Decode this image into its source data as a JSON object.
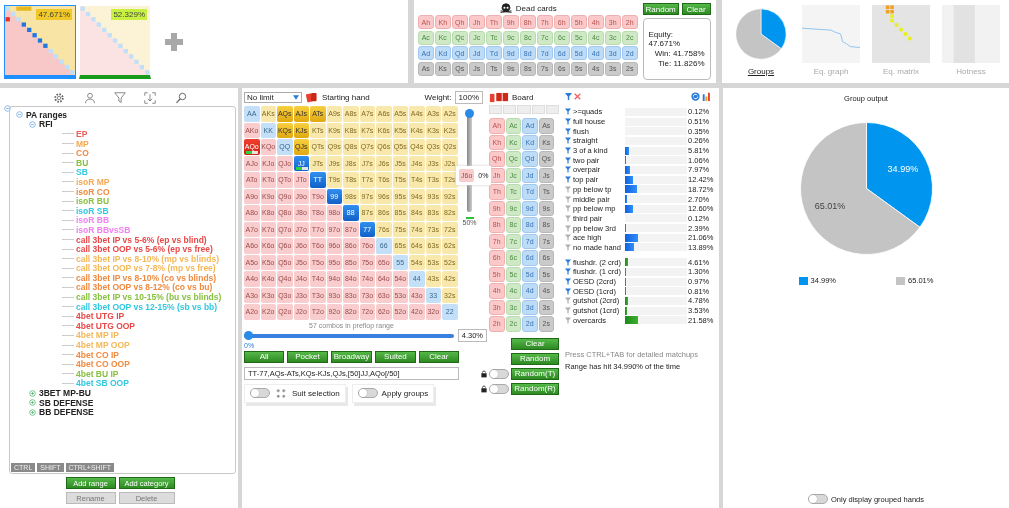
{
  "ranges": [
    {
      "value": "47.671%",
      "selected": true,
      "color": "#1e90ff"
    },
    {
      "value": "52.329%",
      "selected": false,
      "color": "#1a9a1a"
    }
  ],
  "dead_cards": {
    "title": "Dead cards",
    "rows": [
      [
        "Ah",
        "Kh",
        "Qh",
        "Jh",
        "Th",
        "9h",
        "8h",
        "7h",
        "6h",
        "5h",
        "4h",
        "3h",
        "2h"
      ],
      [
        "Ac",
        "Kc",
        "Qc",
        "Jc",
        "Tc",
        "9c",
        "8c",
        "7c",
        "6c",
        "5c",
        "4c",
        "3c",
        "2c"
      ],
      [
        "Ad",
        "Kd",
        "Qd",
        "Jd",
        "Td",
        "9d",
        "8d",
        "7d",
        "6d",
        "5d",
        "4d",
        "3d",
        "2d"
      ],
      [
        "As",
        "Ks",
        "Qs",
        "Js",
        "Ts",
        "9s",
        "8s",
        "7s",
        "6s",
        "5s",
        "4s",
        "3s",
        "2s"
      ]
    ],
    "buttons": [
      "Random",
      "Clear"
    ]
  },
  "equity": [
    "Equity: 47.671%",
    "Win: 41.758%",
    "Tie: 11.826%"
  ],
  "views": [
    {
      "label": "Groups",
      "selected": true,
      "kind": "pie"
    },
    {
      "label": "Eq. graph",
      "selected": false,
      "kind": "graph"
    },
    {
      "label": "Eq. matrix",
      "selected": false,
      "kind": "matrix"
    },
    {
      "label": "Hotness",
      "selected": false,
      "kind": "hotness"
    }
  ],
  "tree": [
    {
      "label": "PA ranges",
      "expanded": true,
      "children": [
        {
          "label": "RFI",
          "expanded": true,
          "children": [
            {
              "label": "EP",
              "color": "#e8605a"
            },
            {
              "label": "MP",
              "color": "#f5a850"
            },
            {
              "label": "CO",
              "color": "#f08a40"
            },
            {
              "label": "BU",
              "color": "#88c040"
            },
            {
              "label": "SB",
              "color": "#30c8e0"
            },
            {
              "label": "isoR MP",
              "color": "#f5a850"
            },
            {
              "label": "isoR CO",
              "color": "#f08a40"
            },
            {
              "label": "isoR BU",
              "color": "#88c040"
            },
            {
              "label": "isoR SB",
              "color": "#30c8e0"
            },
            {
              "label": "isoR BB",
              "color": "#f080f0"
            },
            {
              "label": "isoR BBvsSB",
              "color": "#f080f0"
            },
            {
              "label": "call 3bet IP vs 5-6% (ep vs blind)",
              "color": "#e84848"
            },
            {
              "label": "call 3bet OOP vs 5-6% (ep vs free)",
              "color": "#e84848"
            },
            {
              "label": "call 3bet IP vs 8-10% (mp vs blinds)",
              "color": "#f5b858"
            },
            {
              "label": "call 3bet OOP vs 7-8% (mp vs free)",
              "color": "#f5b858"
            },
            {
              "label": "call 3bet IP vs 8-10% (co vs blinds)",
              "color": "#f08a40"
            },
            {
              "label": "call 3bet OOP vs 8-12% (co vs bu)",
              "color": "#f08a40"
            },
            {
              "label": "call 3bet IP vs 10-15% (bu vs blinds)",
              "color": "#88c040"
            },
            {
              "label": "call 3bet OOP vs 12-15% (sb vs bb)",
              "color": "#30c8e0"
            },
            {
              "label": "4bet UTG IP",
              "color": "#e84848"
            },
            {
              "label": "4bet UTG OOP",
              "color": "#e84848"
            },
            {
              "label": "4bet MP IP",
              "color": "#f5b858"
            },
            {
              "label": "4bet MP OOP",
              "color": "#f5b858"
            },
            {
              "label": "4bet CO IP",
              "color": "#f08a40"
            },
            {
              "label": "4bet CO OOP",
              "color": "#f08a40"
            },
            {
              "label": "4bet BU IP",
              "color": "#88c040"
            },
            {
              "label": "4bet SB OOP",
              "color": "#30c8e0"
            }
          ]
        },
        {
          "label": "3BET MP-BU",
          "expanded": false
        },
        {
          "label": "SB DEFENSE",
          "expanded": false
        },
        {
          "label": "BB DEFENSE",
          "expanded": false
        }
      ]
    }
  ],
  "keys": [
    "CTRL",
    "SHIFT",
    "CTRL+SHIFT"
  ],
  "tree_buttons": [
    {
      "label": "Add range",
      "disabled": false
    },
    {
      "label": "Add category",
      "disabled": false
    },
    {
      "label": "Rename",
      "disabled": true
    },
    {
      "label": "Delete",
      "disabled": true
    }
  ],
  "hand_panel": {
    "game": "No limit",
    "title": "Starting hand",
    "weight_label": "Weight:",
    "weight": "100%",
    "weight_slider": {
      "level": 1
    },
    "weight_mark": "50%",
    "tooltip": {
      "hand": "J6o",
      "value": "0%"
    },
    "rows": [
      [
        {
          "label": "AA",
          "selected": false
        },
        {
          "label": "AKs",
          "selected": false
        },
        {
          "label": "AQs",
          "selected": true
        },
        {
          "label": "AJs",
          "selected": true
        },
        {
          "label": "ATs",
          "selected": true
        },
        {
          "label": "A9s",
          "selected": false
        },
        {
          "label": "A8s",
          "selected": false
        },
        {
          "label": "A7s",
          "selected": false
        },
        {
          "label": "A6s",
          "selected": false
        },
        {
          "label": "A5s",
          "selected": false
        },
        {
          "label": "A4s",
          "selected": false
        },
        {
          "label": "A3s",
          "selected": false
        },
        {
          "label": "A2s",
          "selected": false
        }
      ],
      [
        {
          "label": "AKo",
          "selected": false
        },
        {
          "label": "KK",
          "selected": false
        },
        {
          "label": "KQs",
          "selected": true
        },
        {
          "label": "KJs",
          "selected": true
        },
        {
          "label": "KTs",
          "selected": false
        },
        {
          "label": "K9s",
          "selected": false
        },
        {
          "label": "K8s",
          "selected": false
        },
        {
          "label": "K7s",
          "selected": false
        },
        {
          "label": "K6s",
          "selected": false
        },
        {
          "label": "K5s",
          "selected": false
        },
        {
          "label": "K4s",
          "selected": false
        },
        {
          "label": "K3s",
          "selected": false
        },
        {
          "label": "K2s",
          "selected": false
        }
      ],
      [
        {
          "label": "AQo",
          "selected": true,
          "level": 0.5
        },
        {
          "label": "KQo",
          "selected": false
        },
        {
          "label": "QQ",
          "selected": false
        },
        {
          "label": "QJs",
          "selected": true
        },
        {
          "label": "QTs",
          "selected": false
        },
        {
          "label": "Q9s",
          "selected": false
        },
        {
          "label": "Q8s",
          "selected": false
        },
        {
          "label": "Q7s",
          "selected": false
        },
        {
          "label": "Q6s",
          "selected": false
        },
        {
          "label": "Q5s",
          "selected": false
        },
        {
          "label": "Q4s",
          "selected": false
        },
        {
          "label": "Q3s",
          "selected": false
        },
        {
          "label": "Q2s",
          "selected": false
        }
      ],
      [
        {
          "label": "AJo",
          "selected": false
        },
        {
          "label": "KJo",
          "selected": false
        },
        {
          "label": "QJo",
          "selected": false
        },
        {
          "label": "JJ",
          "selected": true,
          "level": 0.5
        },
        {
          "label": "JTs",
          "selected": false
        },
        {
          "label": "J9s",
          "selected": false
        },
        {
          "label": "J8s",
          "selected": false
        },
        {
          "label": "J7s",
          "selected": false
        },
        {
          "label": "J6s",
          "selected": false
        },
        {
          "label": "J5s",
          "selected": false
        },
        {
          "label": "J4s",
          "selected": false
        },
        {
          "label": "J3s",
          "selected": false
        },
        {
          "label": "J2s",
          "selected": false
        }
      ],
      [
        {
          "label": "ATo",
          "selected": false
        },
        {
          "label": "KTo",
          "selected": false
        },
        {
          "label": "QTo",
          "selected": false
        },
        {
          "label": "JTo",
          "selected": false
        },
        {
          "label": "TT",
          "selected": true
        },
        {
          "label": "T9s",
          "selected": false
        },
        {
          "label": "T8s",
          "selected": false
        },
        {
          "label": "T7s",
          "selected": false
        },
        {
          "label": "T6s",
          "selected": false
        },
        {
          "label": "T5s",
          "selected": false
        },
        {
          "label": "T4s",
          "selected": false
        },
        {
          "label": "T3s",
          "selected": false
        },
        {
          "label": "T2s",
          "selected": false
        }
      ],
      [
        {
          "label": "A9o",
          "selected": false
        },
        {
          "label": "K9o",
          "selected": false
        },
        {
          "label": "Q9o",
          "selected": false
        },
        {
          "label": "J9o",
          "selected": false
        },
        {
          "label": "T9o",
          "selected": false
        },
        {
          "label": "99",
          "selected": true
        },
        {
          "label": "98s",
          "selected": false
        },
        {
          "label": "97s",
          "selected": false
        },
        {
          "label": "96s",
          "selected": false
        },
        {
          "label": "95s",
          "selected": false
        },
        {
          "label": "94s",
          "selected": false
        },
        {
          "label": "93s",
          "selected": false
        },
        {
          "label": "92s",
          "selected": false
        }
      ],
      [
        {
          "label": "A8o",
          "selected": false
        },
        {
          "label": "K8o",
          "selected": false
        },
        {
          "label": "Q8o",
          "selected": false
        },
        {
          "label": "J8o",
          "selected": false
        },
        {
          "label": "T8o",
          "selected": false
        },
        {
          "label": "98o",
          "selected": false
        },
        {
          "label": "88",
          "selected": true
        },
        {
          "label": "87s",
          "selected": false
        },
        {
          "label": "86s",
          "selected": false
        },
        {
          "label": "85s",
          "selected": false
        },
        {
          "label": "84s",
          "selected": false
        },
        {
          "label": "83s",
          "selected": false
        },
        {
          "label": "82s",
          "selected": false
        }
      ],
      [
        {
          "label": "A7o",
          "selected": false
        },
        {
          "label": "K7o",
          "selected": false
        },
        {
          "label": "Q7o",
          "selected": false
        },
        {
          "label": "J7o",
          "selected": false
        },
        {
          "label": "T7o",
          "selected": false
        },
        {
          "label": "97o",
          "selected": false
        },
        {
          "label": "87o",
          "selected": false
        },
        {
          "label": "77",
          "selected": true
        },
        {
          "label": "76s",
          "selected": false
        },
        {
          "label": "75s",
          "selected": false
        },
        {
          "label": "74s",
          "selected": false
        },
        {
          "label": "73s",
          "selected": false
        },
        {
          "label": "72s",
          "selected": false
        }
      ],
      [
        {
          "label": "A6o",
          "selected": false
        },
        {
          "label": "K6o",
          "selected": false
        },
        {
          "label": "Q6o",
          "selected": false
        },
        {
          "label": "J6o",
          "selected": false
        },
        {
          "label": "T6o",
          "selected": false
        },
        {
          "label": "96o",
          "selected": false
        },
        {
          "label": "86o",
          "selected": false
        },
        {
          "label": "76o",
          "selected": false
        },
        {
          "label": "66",
          "selected": false
        },
        {
          "label": "65s",
          "selected": false
        },
        {
          "label": "64s",
          "selected": false
        },
        {
          "label": "63s",
          "selected": false
        },
        {
          "label": "62s",
          "selected": false
        }
      ],
      [
        {
          "label": "A5o",
          "selected": false
        },
        {
          "label": "K5o",
          "selected": false
        },
        {
          "label": "Q5o",
          "selected": false
        },
        {
          "label": "J5o",
          "selected": false
        },
        {
          "label": "T5o",
          "selected": false
        },
        {
          "label": "95o",
          "selected": false
        },
        {
          "label": "85o",
          "selected": false
        },
        {
          "label": "75o",
          "selected": false
        },
        {
          "label": "65o",
          "selected": false
        },
        {
          "label": "55",
          "selected": false
        },
        {
          "label": "54s",
          "selected": false
        },
        {
          "label": "53s",
          "selected": false
        },
        {
          "label": "52s",
          "selected": false
        }
      ],
      [
        {
          "label": "A4o",
          "selected": false
        },
        {
          "label": "K4o",
          "selected": false
        },
        {
          "label": "Q4o",
          "selected": false
        },
        {
          "label": "J4o",
          "selected": false
        },
        {
          "label": "T4o",
          "selected": false
        },
        {
          "label": "94o",
          "selected": false
        },
        {
          "label": "84o",
          "selected": false
        },
        {
          "label": "74o",
          "selected": false
        },
        {
          "label": "64o",
          "selected": false
        },
        {
          "label": "54o",
          "selected": false
        },
        {
          "label": "44",
          "selected": false
        },
        {
          "label": "43s",
          "selected": false
        },
        {
          "label": "42s",
          "selected": false
        }
      ],
      [
        {
          "label": "A3o",
          "selected": false
        },
        {
          "label": "K3o",
          "selected": false
        },
        {
          "label": "Q3o",
          "selected": false
        },
        {
          "label": "J3o",
          "selected": false
        },
        {
          "label": "T3o",
          "selected": false
        },
        {
          "label": "93o",
          "selected": false
        },
        {
          "label": "83o",
          "selected": false
        },
        {
          "label": "73o",
          "selected": false
        },
        {
          "label": "63o",
          "selected": false
        },
        {
          "label": "53o",
          "selected": false
        },
        {
          "label": "43o",
          "selected": false
        },
        {
          "label": "33",
          "selected": false
        },
        {
          "label": "32s",
          "selected": false
        }
      ],
      [
        {
          "label": "A2o",
          "selected": false
        },
        {
          "label": "K2o",
          "selected": false
        },
        {
          "label": "Q2o",
          "selected": false
        },
        {
          "label": "J2o",
          "selected": false
        },
        {
          "label": "T2o",
          "selected": false
        },
        {
          "label": "92o",
          "selected": false
        },
        {
          "label": "82o",
          "selected": false
        },
        {
          "label": "72o",
          "selected": false
        },
        {
          "label": "62o",
          "selected": false
        },
        {
          "label": "52o",
          "selected": false
        },
        {
          "label": "42o",
          "selected": false
        },
        {
          "label": "32o",
          "selected": false
        },
        {
          "label": "22",
          "selected": false
        }
      ]
    ],
    "combos": "57 combos in preflop range",
    "range_slider": {
      "level": 0
    },
    "range_min": "0%",
    "range_percent": "4.30%",
    "buttons": [
      "All",
      "Pocket",
      "Broadway",
      "Suited",
      "Clear"
    ],
    "range_text": "TT-77,AQs-ATs,KQs-KJs,QJs,[50]JJ,AQo[/50]",
    "suit_selection": {
      "label": "Suit selection",
      "on": false
    },
    "apply_groups": {
      "label": "Apply groups",
      "on": false
    }
  },
  "board": {
    "title": "Board",
    "rows": [
      [
        "Ah",
        "Ac",
        "Ad",
        "As"
      ],
      [
        "Kh",
        "Kc",
        "Kd",
        "Ks"
      ],
      [
        "Qh",
        "Qc",
        "Qd",
        "Qs"
      ],
      [
        "Jh",
        "Jc",
        "Jd",
        "Js"
      ],
      [
        "Th",
        "Tc",
        "Td",
        "Ts"
      ],
      [
        "9h",
        "9c",
        "9d",
        "9s"
      ],
      [
        "8h",
        "8c",
        "8d",
        "8s"
      ],
      [
        "7h",
        "7c",
        "7d",
        "7s"
      ],
      [
        "6h",
        "6c",
        "6d",
        "6s"
      ],
      [
        "5h",
        "5c",
        "5d",
        "5s"
      ],
      [
        "4h",
        "4c",
        "4d",
        "4s"
      ],
      [
        "3h",
        "3c",
        "3d",
        "3s"
      ],
      [
        "2h",
        "2c",
        "2d",
        "2s"
      ]
    ],
    "buttons": [
      {
        "label": "Clear"
      },
      {
        "label": "Random"
      },
      {
        "label": "Random(T)",
        "lock": {
          "on": false
        }
      },
      {
        "label": "Random(R)",
        "lock": {
          "on": false
        }
      }
    ]
  },
  "stats": {
    "made_hands": [
      {
        "label": ">=quads",
        "active": true,
        "level": 0.0012,
        "value": "0.12%"
      },
      {
        "label": "full house",
        "active": true,
        "level": 0.0051,
        "value": "0.51%"
      },
      {
        "label": "flush",
        "active": true,
        "level": 0.0035,
        "value": "0.35%"
      },
      {
        "label": "straight",
        "active": true,
        "level": 0.0026,
        "value": "0.26%"
      },
      {
        "label": "3 of a kind",
        "active": true,
        "level": 0.0581,
        "value": "5.81%"
      },
      {
        "label": "two pair",
        "active": true,
        "level": 0.0106,
        "value": "1.06%"
      },
      {
        "label": "overpair",
        "active": true,
        "level": 0.0797,
        "value": "7.97%"
      },
      {
        "label": "top pair",
        "active": true,
        "level": 0.1242,
        "value": "12.42%"
      },
      {
        "label": "pp below tp",
        "active": false,
        "level": 0.1872,
        "value": "18.72%"
      },
      {
        "label": "middle pair",
        "active": false,
        "level": 0.027,
        "value": "2.70%"
      },
      {
        "label": "pp below mp",
        "active": false,
        "level": 0.126,
        "value": "12.60%"
      },
      {
        "label": "third pair",
        "active": false,
        "level": 0.0012,
        "value": "0.12%"
      },
      {
        "label": "pp below 3rd",
        "active": false,
        "level": 0.0239,
        "value": "2.39%"
      },
      {
        "label": "ace high",
        "active": false,
        "level": 0.2106,
        "value": "21.06%"
      },
      {
        "label": "no made hand",
        "active": false,
        "level": 0.1389,
        "value": "13.89%"
      }
    ],
    "draws": [
      {
        "label": "flushdr. (2 crd)",
        "active": true,
        "level": 0.0461,
        "value": "4.61%"
      },
      {
        "label": "flushdr. (1 crd)",
        "active": true,
        "level": 0.013,
        "value": "1.30%"
      },
      {
        "label": "OESD (2crd)",
        "active": true,
        "level": 0.0097,
        "value": "0.97%"
      },
      {
        "label": "OESD (1crd)",
        "active": true,
        "level": 0.0081,
        "value": "0.81%"
      },
      {
        "label": "gutshot (2crd)",
        "active": false,
        "level": 0.0478,
        "value": "4.78%"
      },
      {
        "label": "gutshot (1crd)",
        "active": false,
        "level": 0.0353,
        "value": "3.53%"
      },
      {
        "label": "overcards",
        "active": false,
        "level": 0.2158,
        "value": "21.58%"
      }
    ],
    "hint": "Press CTRL+TAB for detailed matchups",
    "hit_text": "Range has hit 34.990% of the time"
  },
  "group_output": {
    "chart_data": {
      "type": "pie",
      "title": "Group output",
      "categories": [
        "34.99%",
        "65.01%"
      ],
      "values": [
        34.99,
        65.01
      ],
      "value_labels": [
        "34.99%",
        "65.01%"
      ]
    }
  },
  "only_grouped": {
    "label": "Only display grouped hands",
    "on": false
  }
}
